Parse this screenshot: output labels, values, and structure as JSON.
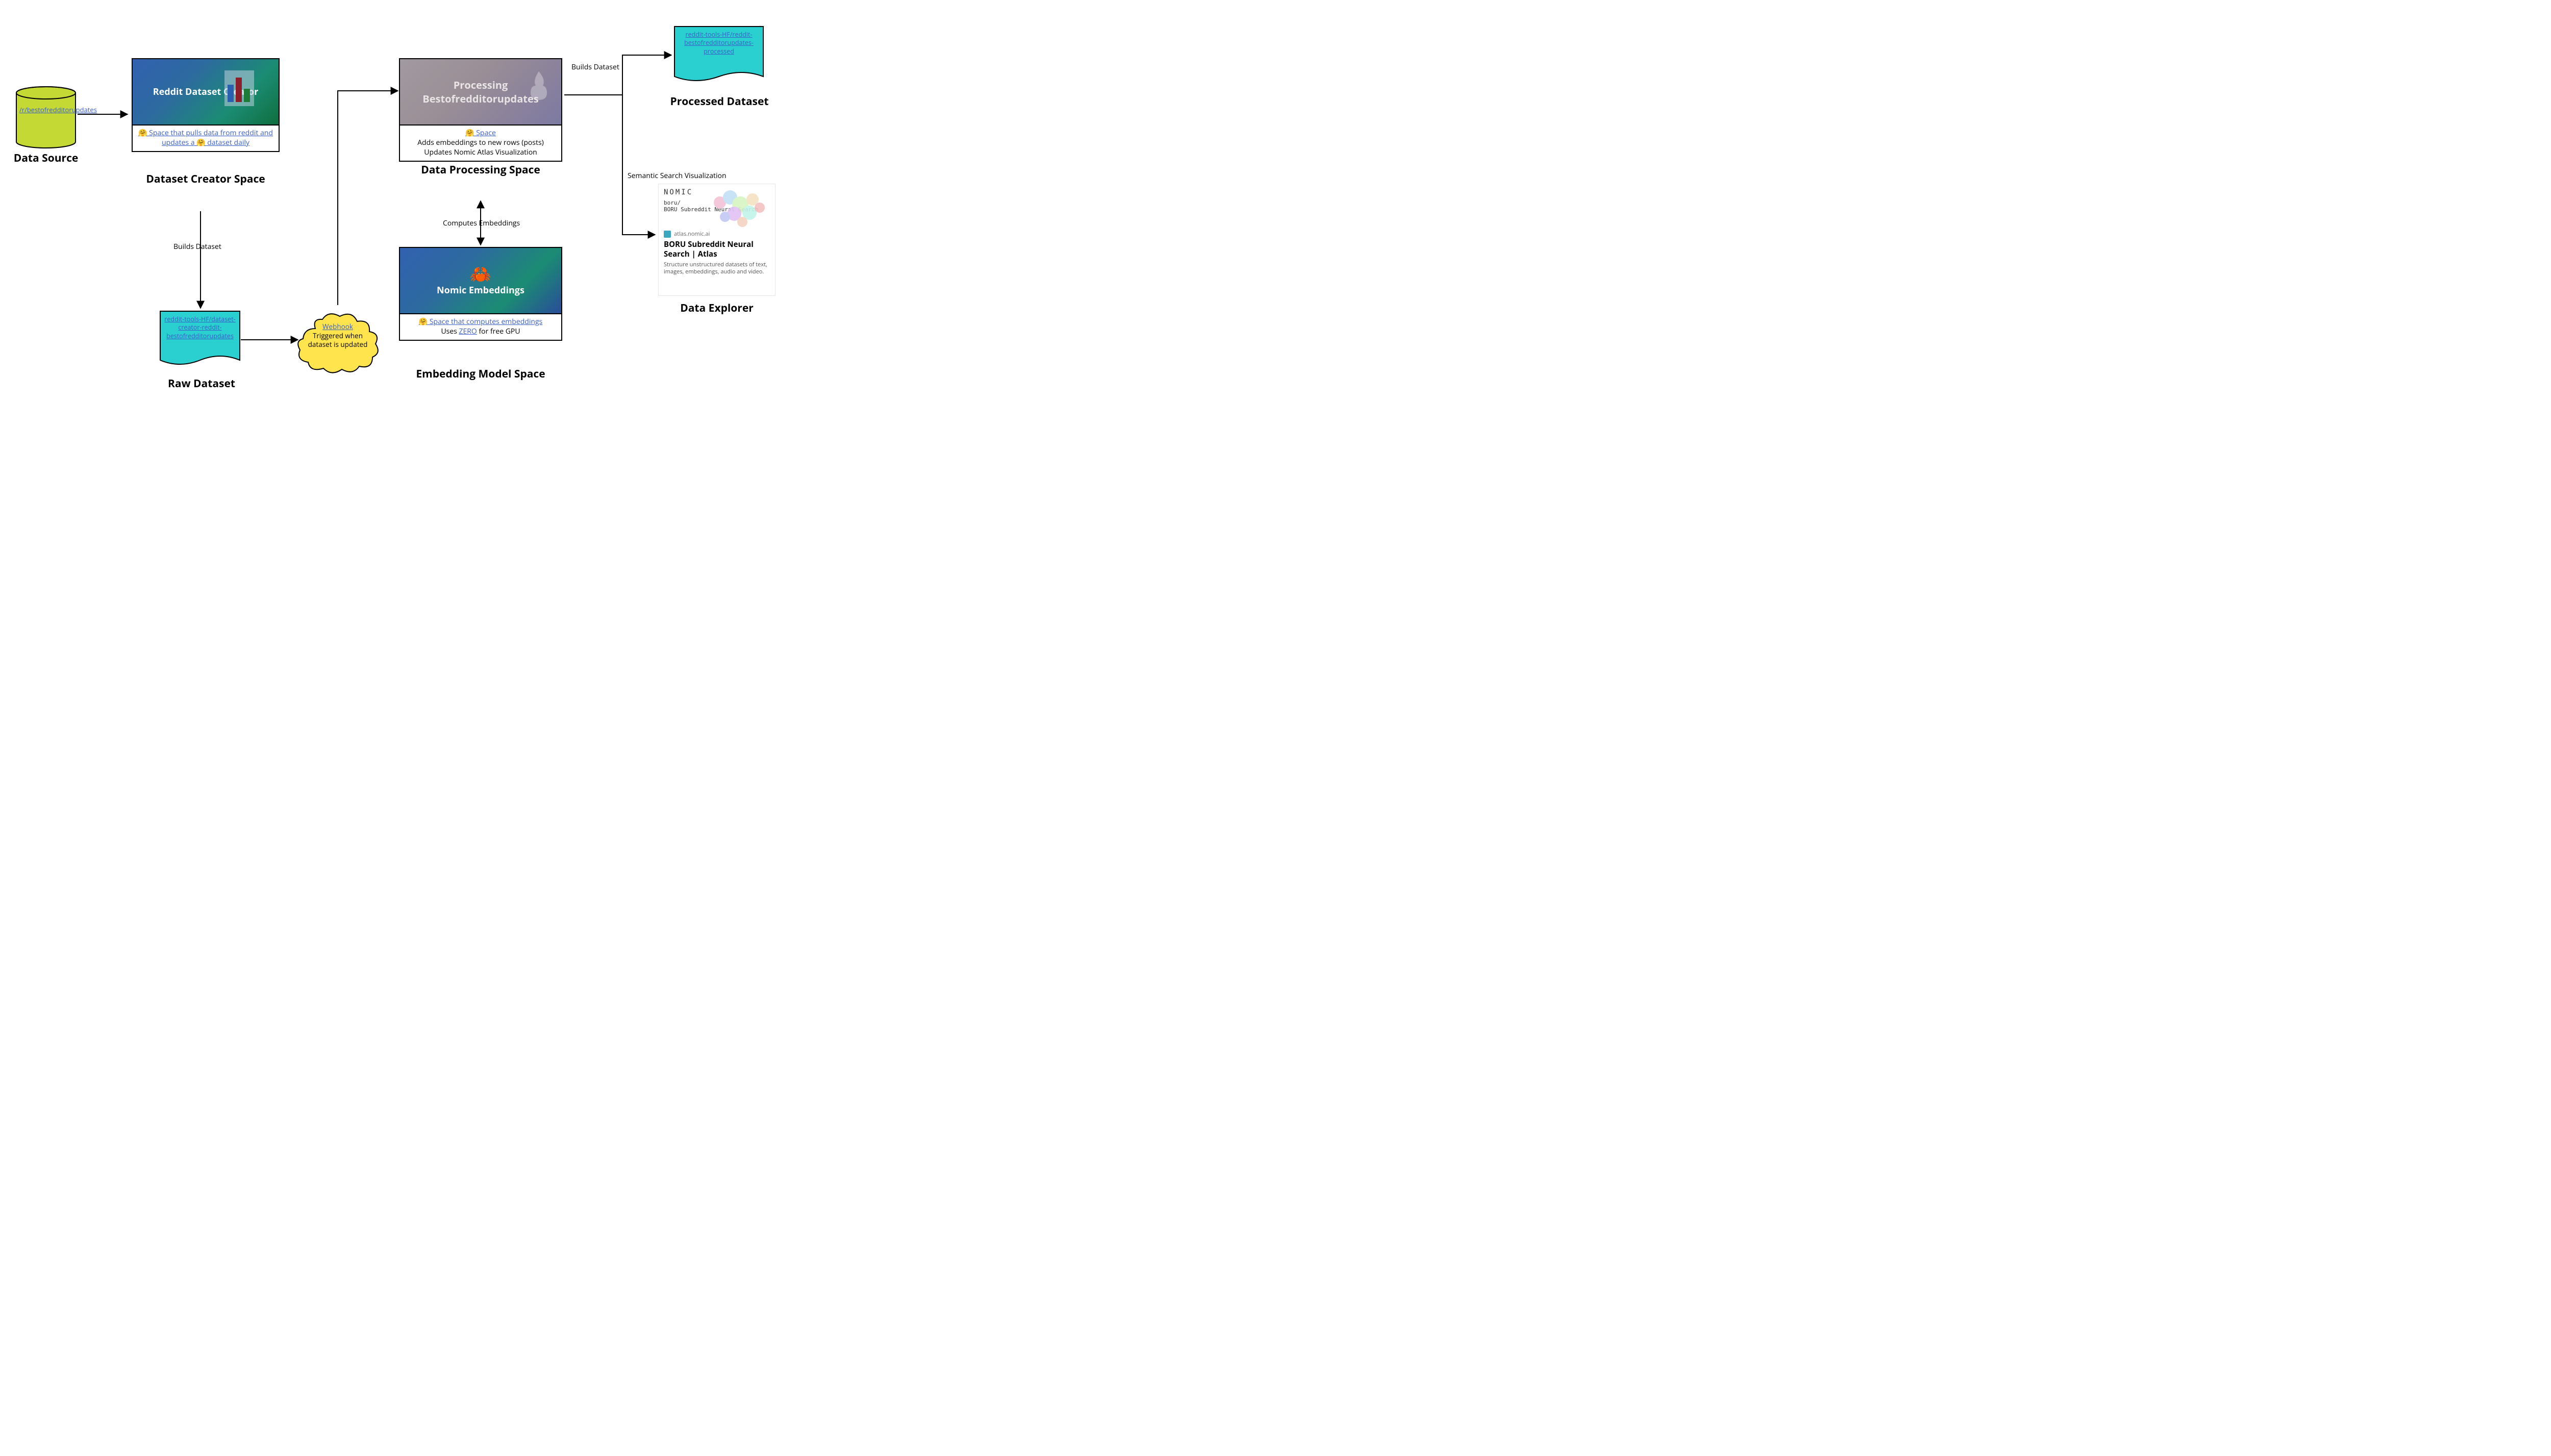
{
  "dataSource": {
    "link_text": "/r/bestofredditorupdates",
    "label": "Data Source"
  },
  "creatorSpace": {
    "banner_title": "Reddit Dataset Creator",
    "body_link": "🤗  Space that pulls data from reddit and updates a 🤗  dataset daily",
    "label": "Dataset Creator Space"
  },
  "rawDataset": {
    "link_text": "reddit-tools-HF/dataset-creator-reddit-bestofredditorupdates",
    "label": "Raw Dataset"
  },
  "webhook": {
    "link_text": "Webhook",
    "line2": "Triggered when dataset is updated"
  },
  "processingSpace": {
    "banner_title": "Processing Bestofredditorupdates",
    "body_link": "🤗  Space",
    "body_line1": "Adds embeddings to new rows (posts)",
    "body_line2": "Updates Nomic Atlas Visualization",
    "label": "Data Processing Space"
  },
  "embeddingSpace": {
    "banner_title": "Nomic Embeddings",
    "crab": "🦀",
    "body_link": "🤗  Space that computes embeddings",
    "body_line2_pre": "Uses ",
    "body_line2_link": "ZERO",
    "body_line2_post": " for free GPU",
    "label": "Embedding Model Space"
  },
  "processedDataset": {
    "link_text": "reddit-tools-HF/reddit-bestofredditorupdates-processed",
    "label": "Processed Dataset"
  },
  "explorer": {
    "logo": "NOMIC",
    "subhead1": "boru/",
    "subhead2": "BORU Subreddit Neural Search",
    "atlas": "atlas.nomic.ai",
    "title": "BORU Subreddit Neural Search | Atlas",
    "desc": "Structure unstructured datasets of text, images, embeddings, audio and video.",
    "label": "Data Explorer"
  },
  "edges": {
    "builds_dataset_1": "Builds Dataset",
    "builds_dataset_2": "Builds Dataset",
    "computes_embeddings": "Computes Embeddings",
    "semantic_search": "Semantic Search Visualization"
  }
}
